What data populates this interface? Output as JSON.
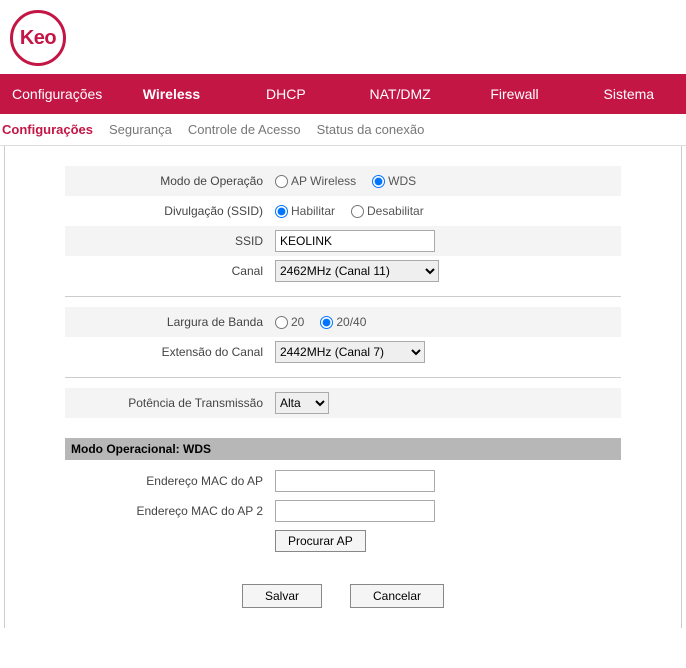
{
  "brand": "Keo",
  "nav": {
    "items": [
      "Configurações",
      "Wireless",
      "DHCP",
      "NAT/DMZ",
      "Firewall",
      "Sistema"
    ],
    "activeIndex": 1
  },
  "subnav": {
    "items": [
      "Configurações",
      "Segurança",
      "Controle de Acesso",
      "Status da conexão"
    ],
    "activeIndex": 0
  },
  "labels": {
    "modoOperacao": "Modo de Operação",
    "divulgacao": "Divulgação (SSID)",
    "ssid": "SSID",
    "canal": "Canal",
    "larguraBanda": "Largura de Banda",
    "extensaoCanal": "Extensão do Canal",
    "potencia": "Potência de Transmissão",
    "macAp": "Endereço MAC do AP",
    "macAp2": "Endereço MAC do AP 2"
  },
  "options": {
    "modoAp": "AP Wireless",
    "modoWds": "WDS",
    "habilitar": "Habilitar",
    "desabilitar": "Desabilitar",
    "bw20": "20",
    "bw2040": "20/40"
  },
  "values": {
    "modoOperacao": "WDS",
    "divulgacao": "Habilitar",
    "ssid": "KEOLINK",
    "canal": "2462MHz (Canal 11)",
    "larguraBanda": "20/40",
    "extensaoCanal": "2442MHz (Canal 7)",
    "potencia": "Alta",
    "macAp": "",
    "macAp2": ""
  },
  "sectionTitle": "Modo Operacional: WDS",
  "buttons": {
    "procurar": "Procurar AP",
    "salvar": "Salvar",
    "cancelar": "Cancelar"
  }
}
